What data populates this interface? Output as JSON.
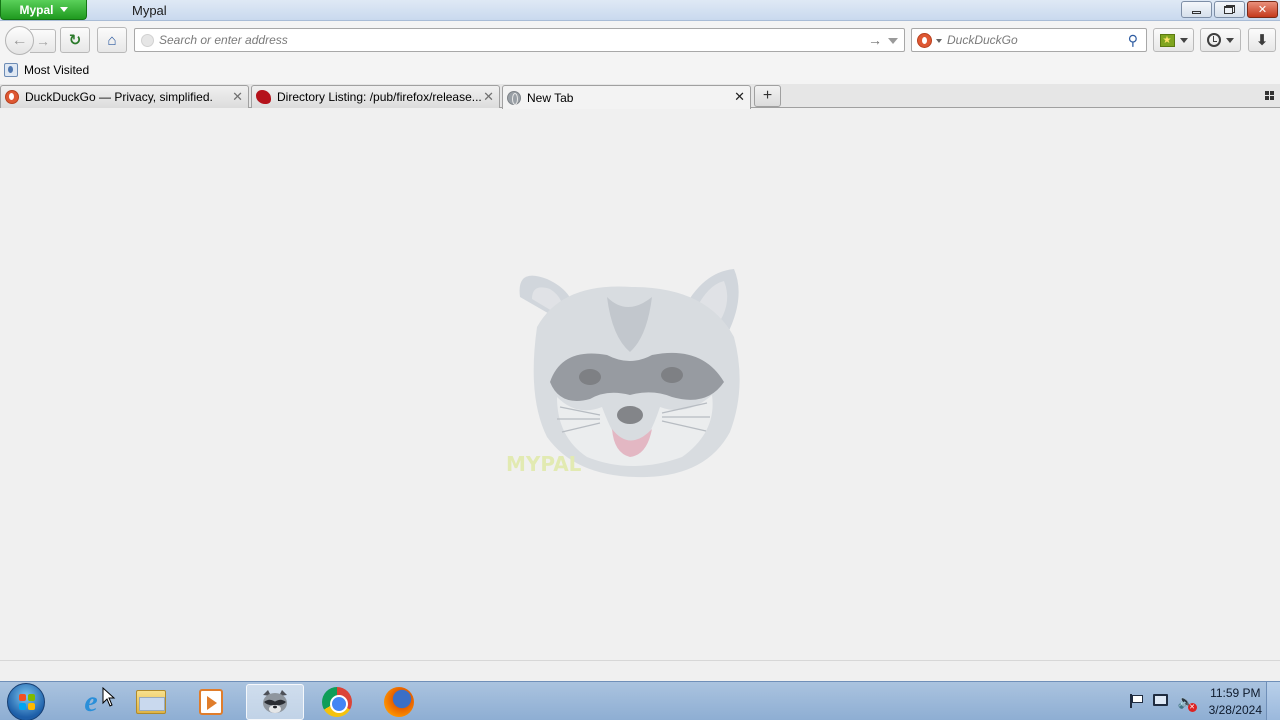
{
  "window": {
    "app_menu_label": "Mypal",
    "title": "Mypal"
  },
  "toolbar": {
    "back_icon": "back-arrow-icon",
    "forward_icon": "forward-arrow-icon",
    "reload_icon": "reload-icon",
    "home_icon": "home-icon",
    "address_placeholder": "Search or enter address",
    "address_value": "",
    "search_placeholder": "DuckDuckGo",
    "search_value": ""
  },
  "bookmarks": {
    "items": [
      {
        "label": "Most Visited",
        "icon": "folder-icon"
      }
    ]
  },
  "tabs": [
    {
      "label": "DuckDuckGo — Privacy, simplified.",
      "icon": "duckduckgo-icon",
      "active": false
    },
    {
      "label": "Directory Listing: /pub/firefox/release...",
      "icon": "directory-icon",
      "active": false
    },
    {
      "label": "New Tab",
      "icon": "globe-icon",
      "active": true
    }
  ],
  "content": {
    "logo_text": "MYPAL"
  },
  "taskbar": {
    "apps": [
      "internet-explorer",
      "file-explorer",
      "media-player",
      "mypal",
      "chrome",
      "firefox"
    ],
    "clock_time": "11:59 PM",
    "clock_date": "3/28/2024"
  },
  "colors": {
    "app_menu_green": "#1f9a1f",
    "duckduckgo_orange": "#de5833",
    "taskbar_blue": "#8eaed3"
  }
}
